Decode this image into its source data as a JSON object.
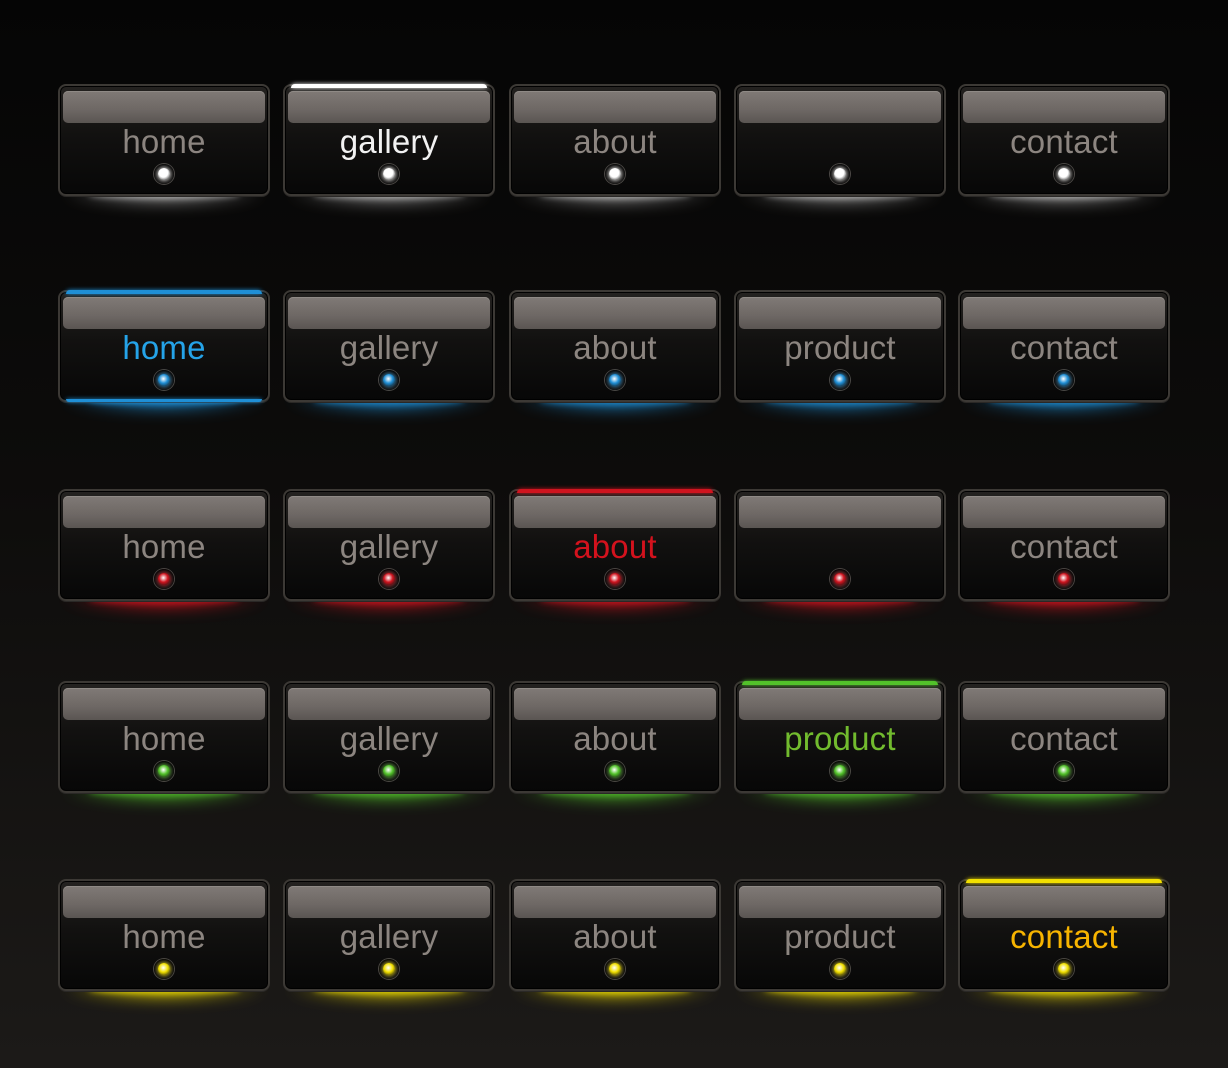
{
  "rows": [
    {
      "theme": "white",
      "accent": "#ffffff",
      "active_text": "#f2f2f2",
      "buttons": [
        {
          "label": "home"
        },
        {
          "label": "gallery",
          "active": true
        },
        {
          "label": "about"
        },
        {
          "label": ""
        },
        {
          "label": "contact"
        }
      ]
    },
    {
      "theme": "blue",
      "accent": "#1f8fd6",
      "active_text": "#25a3e8",
      "buttons": [
        {
          "label": "home",
          "active": true
        },
        {
          "label": "gallery"
        },
        {
          "label": "about"
        },
        {
          "label": "product"
        },
        {
          "label": "contact"
        }
      ]
    },
    {
      "theme": "red",
      "accent": "#d0141f",
      "active_text": "#d3121d",
      "buttons": [
        {
          "label": "home"
        },
        {
          "label": "gallery"
        },
        {
          "label": "about",
          "active": true
        },
        {
          "label": ""
        },
        {
          "label": "contact"
        }
      ]
    },
    {
      "theme": "green",
      "accent": "#52c22a",
      "active_text": "#72bb2e",
      "buttons": [
        {
          "label": "home"
        },
        {
          "label": "gallery"
        },
        {
          "label": "about"
        },
        {
          "label": "product",
          "active": true
        },
        {
          "label": "contact"
        }
      ]
    },
    {
      "theme": "yellow",
      "accent": "#f2e000",
      "active_text": "#f7b400",
      "buttons": [
        {
          "label": "home"
        },
        {
          "label": "gallery"
        },
        {
          "label": "about"
        },
        {
          "label": "product"
        },
        {
          "label": "contact",
          "active": true
        }
      ]
    }
  ]
}
